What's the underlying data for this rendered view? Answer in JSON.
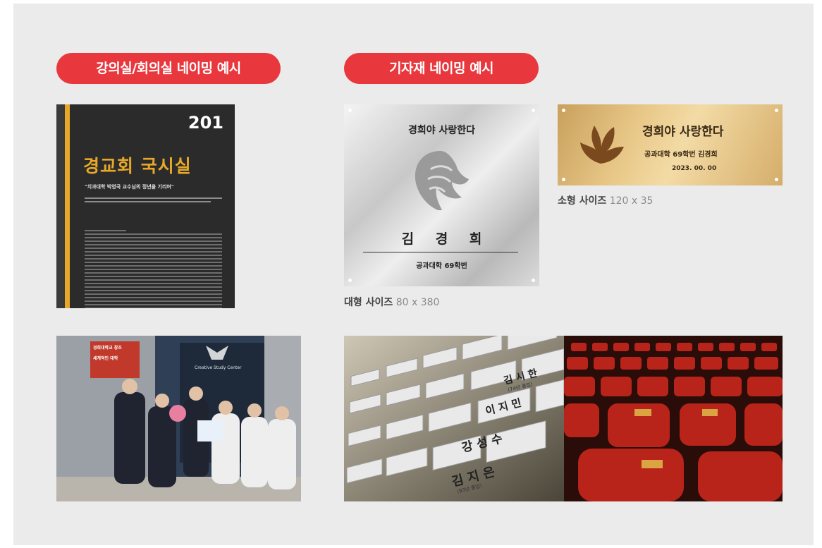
{
  "sections": {
    "lecture_title": "강의실/회의실 네이밍 예시",
    "equipment_title": "기자재 네이밍 예시"
  },
  "lecture_plaque": {
    "room_number": "201",
    "room_name": "경교회 국시실",
    "quote": "\"치과대학 박영국 교수님의 정년을 기리며\""
  },
  "large_plate": {
    "motto": "경희야 사랑한다",
    "name": "김 경 희",
    "affiliation": "공과대학 69학번",
    "caption_label": "대형 사이즈",
    "caption_size": "80 x 380"
  },
  "small_plate": {
    "motto": "경희야 사랑한다",
    "affiliation": "공과대학 69학번 김경희",
    "date": "2023. 00. 00",
    "caption_label": "소형 사이즈",
    "caption_size": "120 x 35"
  },
  "photos": {
    "ceremony": {
      "banner_text_1": "경희대학교 창조",
      "banner_text_2": "세계적인 대학",
      "sign_text": "Creative Study Center"
    },
    "nameplates": {
      "plates": [
        "이 지 민",
        "김 시 한",
        "강 성 수",
        "김 지 은",
        "(93년 졸업)",
        "(74년 졸업)"
      ]
    },
    "seats": {}
  },
  "colors": {
    "accent": "#e8383d",
    "panel_bg": "#ebebeb",
    "plaque_gold": "#e7a829"
  }
}
